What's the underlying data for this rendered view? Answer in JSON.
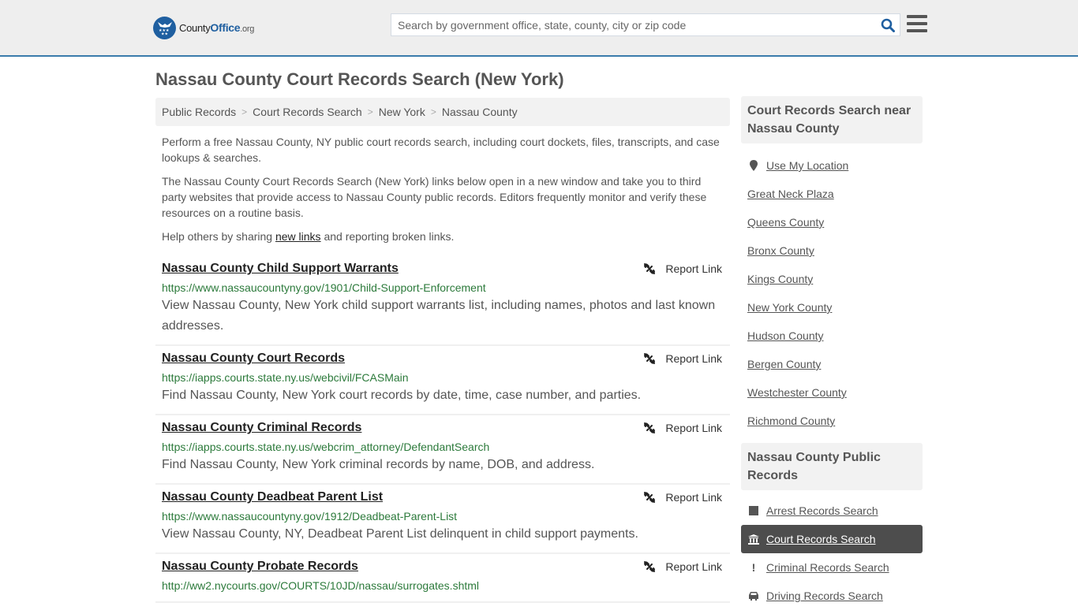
{
  "header": {
    "logo": {
      "prefix": "County",
      "brand": "Office",
      "suffix": ".org"
    },
    "search": {
      "placeholder": "Search by government office, state, county, city or zip code",
      "value": ""
    },
    "colors": {
      "accent": "#1f5fa0",
      "header_bg": "#eeeeee",
      "header_border": "#3a7bab"
    }
  },
  "page": {
    "title": "Nassau County Court Records Search (New York)"
  },
  "breadcrumb": [
    {
      "label": "Public Records"
    },
    {
      "label": "Court Records Search"
    },
    {
      "label": "New York"
    },
    {
      "label": "Nassau County"
    }
  ],
  "intro": {
    "p1": "Perform a free Nassau County, NY public court records search, including court dockets, files, transcripts, and case lookups & searches.",
    "p2": "The Nassau County Court Records Search (New York) links below open in a new window and take you to third party websites that provide access to Nassau County public records. Editors frequently monitor and verify these resources on a routine basis.",
    "p3_before": "Help others by sharing ",
    "p3_link": "new links",
    "p3_after": " and reporting broken links."
  },
  "report_label": "Report Link",
  "results": [
    {
      "title": "Nassau County Child Support Warrants",
      "url": "https://www.nassaucountyny.gov/1901/Child-Support-Enforcement",
      "description": "View Nassau County, New York child support warrants list, including names, photos and last known addresses."
    },
    {
      "title": "Nassau County Court Records",
      "url": "https://iapps.courts.state.ny.us/webcivil/FCASMain",
      "description": "Find Nassau County, New York court records by date, time, case number, and parties."
    },
    {
      "title": "Nassau County Criminal Records",
      "url": "https://iapps.courts.state.ny.us/webcrim_attorney/DefendantSearch",
      "description": "Find Nassau County, New York criminal records by name, DOB, and address."
    },
    {
      "title": "Nassau County Deadbeat Parent List",
      "url": "https://www.nassaucountyny.gov/1912/Deadbeat-Parent-List",
      "description": "View Nassau County, NY, Deadbeat Parent List delinquent in child support payments."
    },
    {
      "title": "Nassau County Probate Records",
      "url": "http://ww2.nycourts.gov/COURTS/10JD/nassau/surrogates.shtml",
      "description": ""
    }
  ],
  "sidebar": {
    "nearby_title": "Court Records Search near Nassau County",
    "use_location": "Use My Location",
    "nearby": [
      "Great Neck Plaza",
      "Queens County",
      "Bronx County",
      "Kings County",
      "New York County",
      "Hudson County",
      "Bergen County",
      "Westchester County",
      "Richmond County"
    ],
    "public_title": "Nassau County Public Records",
    "public_records": [
      {
        "label": "Arrest Records Search",
        "icon": "square-icon",
        "active": false
      },
      {
        "label": "Court Records Search",
        "icon": "courthouse-icon",
        "active": true
      },
      {
        "label": "Criminal Records Search",
        "icon": "exclamation-icon",
        "active": false
      },
      {
        "label": "Driving Records Search",
        "icon": "car-icon",
        "active": false
      }
    ]
  }
}
